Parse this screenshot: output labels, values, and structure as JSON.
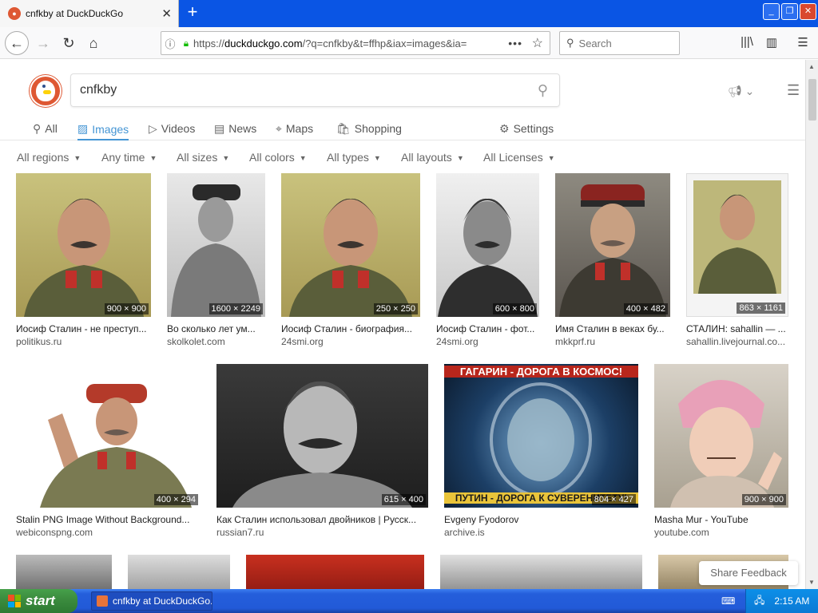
{
  "browser": {
    "tab_title": "cnfkby at DuckDuckGo",
    "url_prefix": "https://",
    "url_domain": "duckduckgo.com",
    "url_rest": "/?q=cnfkby&t=ffhp&iax=images&ia=",
    "search_placeholder": "Search",
    "window_buttons": [
      "_",
      "❐",
      "✕"
    ]
  },
  "ddg": {
    "query": "cnfkby",
    "tabs": [
      {
        "label": "All",
        "icon": "search-icon"
      },
      {
        "label": "Images",
        "icon": "image-icon"
      },
      {
        "label": "Videos",
        "icon": "play-icon"
      },
      {
        "label": "News",
        "icon": "news-icon"
      },
      {
        "label": "Maps",
        "icon": "map-pin-icon"
      },
      {
        "label": "Shopping",
        "icon": "bag-icon"
      }
    ],
    "settings_label": "Settings",
    "filters": [
      "All regions",
      "Any time",
      "All sizes",
      "All colors",
      "All types",
      "All layouts",
      "All Licenses"
    ],
    "share_feedback": "Share Feedback"
  },
  "results": [
    {
      "title": "Иосиф Сталин - не преступ...",
      "source": "politikus.ru",
      "dims": "900 × 900"
    },
    {
      "title": "Во сколько лет ум...",
      "source": "skolkolet.com",
      "dims": "1600 × 2249"
    },
    {
      "title": "Иосиф Сталин - биография...",
      "source": "24smi.org",
      "dims": "250 × 250"
    },
    {
      "title": "Иосиф Сталин - фот...",
      "source": "24smi.org",
      "dims": "600 × 800"
    },
    {
      "title": "Имя Сталин в веках бу...",
      "source": "mkkprf.ru",
      "dims": "400 × 482"
    },
    {
      "title": "СТАЛИН: sahallin — ...",
      "source": "sahallin.livejournal.co...",
      "dims": "863 × 1161"
    },
    {
      "title": "Stalin PNG Image Without Background...",
      "source": "webiconspng.com",
      "dims": "400 × 294"
    },
    {
      "title": "Как Сталин использовал двойников | Русск...",
      "source": "russian7.ru",
      "dims": "615 × 400"
    },
    {
      "title": "Evgeny Fyodorov",
      "source": "archive.is",
      "dims": "804 × 427"
    },
    {
      "title": "Masha Mur - YouTube",
      "source": "youtube.com",
      "dims": "900 × 900"
    }
  ],
  "poster": {
    "top_text": "ГАГАРИН - ДОРОГА В КОСМОС!",
    "bottom_text": "ПУТИН - ДОРОГА К СУВЕРЕНИТЕТУ!"
  },
  "taskbar": {
    "start_label": "start",
    "task_label": "cnfkby at DuckDuckGo...",
    "clock": "2:15 AM"
  },
  "colors": {
    "accent": "#4495d4",
    "ddg_orange": "#de5833",
    "xp_blue": "#245edb",
    "start_green": "#3c8d3f"
  }
}
